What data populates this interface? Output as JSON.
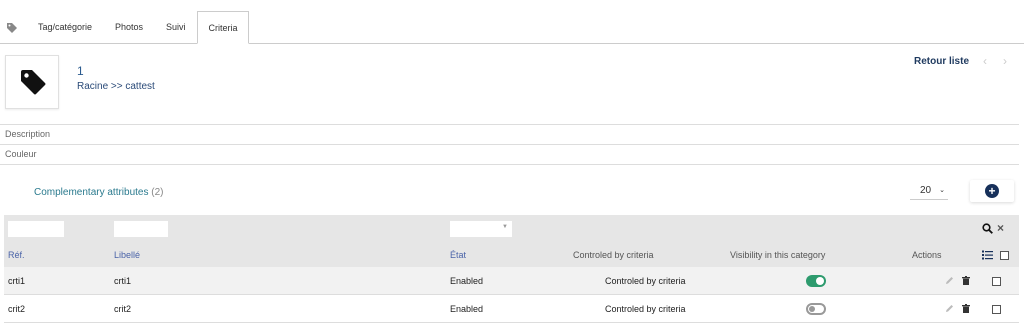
{
  "tabs": [
    {
      "label": "Tag/catégorie"
    },
    {
      "label": "Photos"
    },
    {
      "label": "Suivi"
    },
    {
      "label": "Criteria",
      "active": true
    }
  ],
  "header": {
    "id": "1",
    "path": "Racine >> cattest",
    "back_label": "Retour liste",
    "prev_icon": "chevron-left-icon",
    "next_icon": "chevron-right-icon"
  },
  "fields": {
    "description_label": "Description",
    "color_label": "Couleur"
  },
  "section": {
    "title": "Complementary attributes",
    "count": "(2)",
    "page_size": "20"
  },
  "table": {
    "columns": {
      "ref": "Réf.",
      "label": "Libellé",
      "state": "État",
      "controlled": "Controled by criteria",
      "visibility": "Visibility in this category",
      "actions": "Actions"
    },
    "rows": [
      {
        "ref": "crti1",
        "label": "crti1",
        "state": "Enabled",
        "controlled": "Controled by criteria",
        "visible": true
      },
      {
        "ref": "crit2",
        "label": "crit2",
        "state": "Enabled",
        "controlled": "Controled by criteria",
        "visible": false
      }
    ]
  },
  "colors": {
    "accent": "#17305a",
    "toggle_on": "#2e9b6e",
    "link": "#2a5a8e"
  }
}
